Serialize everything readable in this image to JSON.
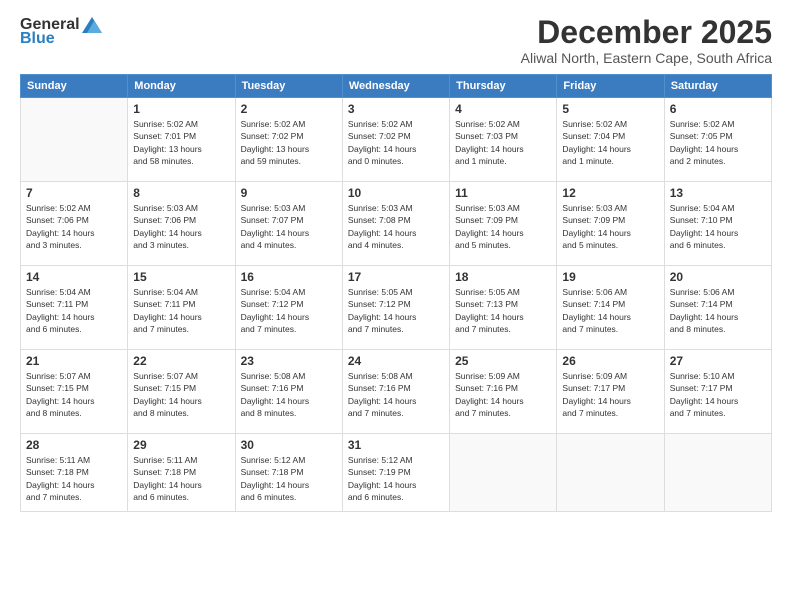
{
  "header": {
    "logo_general": "General",
    "logo_blue": "Blue",
    "month_title": "December 2025",
    "location": "Aliwal North, Eastern Cape, South Africa"
  },
  "weekdays": [
    "Sunday",
    "Monday",
    "Tuesday",
    "Wednesday",
    "Thursday",
    "Friday",
    "Saturday"
  ],
  "rows": [
    [
      {
        "day": "",
        "info": ""
      },
      {
        "day": "1",
        "info": "Sunrise: 5:02 AM\nSunset: 7:01 PM\nDaylight: 13 hours\nand 58 minutes."
      },
      {
        "day": "2",
        "info": "Sunrise: 5:02 AM\nSunset: 7:02 PM\nDaylight: 13 hours\nand 59 minutes."
      },
      {
        "day": "3",
        "info": "Sunrise: 5:02 AM\nSunset: 7:02 PM\nDaylight: 14 hours\nand 0 minutes."
      },
      {
        "day": "4",
        "info": "Sunrise: 5:02 AM\nSunset: 7:03 PM\nDaylight: 14 hours\nand 1 minute."
      },
      {
        "day": "5",
        "info": "Sunrise: 5:02 AM\nSunset: 7:04 PM\nDaylight: 14 hours\nand 1 minute."
      },
      {
        "day": "6",
        "info": "Sunrise: 5:02 AM\nSunset: 7:05 PM\nDaylight: 14 hours\nand 2 minutes."
      }
    ],
    [
      {
        "day": "7",
        "info": "Sunrise: 5:02 AM\nSunset: 7:06 PM\nDaylight: 14 hours\nand 3 minutes."
      },
      {
        "day": "8",
        "info": "Sunrise: 5:03 AM\nSunset: 7:06 PM\nDaylight: 14 hours\nand 3 minutes."
      },
      {
        "day": "9",
        "info": "Sunrise: 5:03 AM\nSunset: 7:07 PM\nDaylight: 14 hours\nand 4 minutes."
      },
      {
        "day": "10",
        "info": "Sunrise: 5:03 AM\nSunset: 7:08 PM\nDaylight: 14 hours\nand 4 minutes."
      },
      {
        "day": "11",
        "info": "Sunrise: 5:03 AM\nSunset: 7:09 PM\nDaylight: 14 hours\nand 5 minutes."
      },
      {
        "day": "12",
        "info": "Sunrise: 5:03 AM\nSunset: 7:09 PM\nDaylight: 14 hours\nand 5 minutes."
      },
      {
        "day": "13",
        "info": "Sunrise: 5:04 AM\nSunset: 7:10 PM\nDaylight: 14 hours\nand 6 minutes."
      }
    ],
    [
      {
        "day": "14",
        "info": "Sunrise: 5:04 AM\nSunset: 7:11 PM\nDaylight: 14 hours\nand 6 minutes."
      },
      {
        "day": "15",
        "info": "Sunrise: 5:04 AM\nSunset: 7:11 PM\nDaylight: 14 hours\nand 7 minutes."
      },
      {
        "day": "16",
        "info": "Sunrise: 5:04 AM\nSunset: 7:12 PM\nDaylight: 14 hours\nand 7 minutes."
      },
      {
        "day": "17",
        "info": "Sunrise: 5:05 AM\nSunset: 7:12 PM\nDaylight: 14 hours\nand 7 minutes."
      },
      {
        "day": "18",
        "info": "Sunrise: 5:05 AM\nSunset: 7:13 PM\nDaylight: 14 hours\nand 7 minutes."
      },
      {
        "day": "19",
        "info": "Sunrise: 5:06 AM\nSunset: 7:14 PM\nDaylight: 14 hours\nand 7 minutes."
      },
      {
        "day": "20",
        "info": "Sunrise: 5:06 AM\nSunset: 7:14 PM\nDaylight: 14 hours\nand 8 minutes."
      }
    ],
    [
      {
        "day": "21",
        "info": "Sunrise: 5:07 AM\nSunset: 7:15 PM\nDaylight: 14 hours\nand 8 minutes."
      },
      {
        "day": "22",
        "info": "Sunrise: 5:07 AM\nSunset: 7:15 PM\nDaylight: 14 hours\nand 8 minutes."
      },
      {
        "day": "23",
        "info": "Sunrise: 5:08 AM\nSunset: 7:16 PM\nDaylight: 14 hours\nand 8 minutes."
      },
      {
        "day": "24",
        "info": "Sunrise: 5:08 AM\nSunset: 7:16 PM\nDaylight: 14 hours\nand 7 minutes."
      },
      {
        "day": "25",
        "info": "Sunrise: 5:09 AM\nSunset: 7:16 PM\nDaylight: 14 hours\nand 7 minutes."
      },
      {
        "day": "26",
        "info": "Sunrise: 5:09 AM\nSunset: 7:17 PM\nDaylight: 14 hours\nand 7 minutes."
      },
      {
        "day": "27",
        "info": "Sunrise: 5:10 AM\nSunset: 7:17 PM\nDaylight: 14 hours\nand 7 minutes."
      }
    ],
    [
      {
        "day": "28",
        "info": "Sunrise: 5:11 AM\nSunset: 7:18 PM\nDaylight: 14 hours\nand 7 minutes."
      },
      {
        "day": "29",
        "info": "Sunrise: 5:11 AM\nSunset: 7:18 PM\nDaylight: 14 hours\nand 6 minutes."
      },
      {
        "day": "30",
        "info": "Sunrise: 5:12 AM\nSunset: 7:18 PM\nDaylight: 14 hours\nand 6 minutes."
      },
      {
        "day": "31",
        "info": "Sunrise: 5:12 AM\nSunset: 7:19 PM\nDaylight: 14 hours\nand 6 minutes."
      },
      {
        "day": "",
        "info": ""
      },
      {
        "day": "",
        "info": ""
      },
      {
        "day": "",
        "info": ""
      }
    ]
  ]
}
